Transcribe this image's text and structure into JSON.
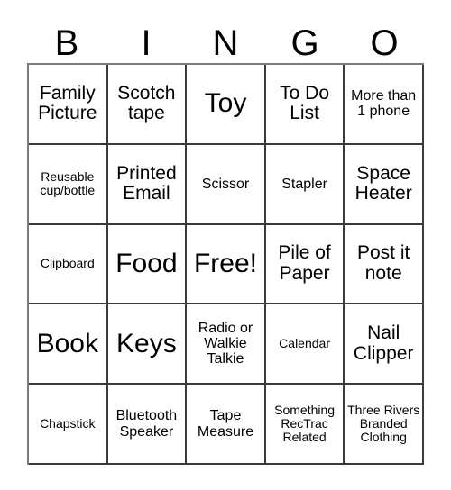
{
  "card": {
    "title_letters": [
      "B",
      "I",
      "N",
      "G",
      "O"
    ],
    "columns": 5,
    "rows": 5,
    "background_color": "#ffffff",
    "text_color": "#000000",
    "grid_border_color": "#3a3a3a",
    "cells": [
      {
        "label": "Family Picture",
        "size": "md"
      },
      {
        "label": "Scotch tape",
        "size": "md"
      },
      {
        "label": "Toy",
        "size": "xl"
      },
      {
        "label": "To Do List",
        "size": "md"
      },
      {
        "label": "More than 1 phone",
        "size": "sm"
      },
      {
        "label": "Reusable cup/bottle",
        "size": "xs"
      },
      {
        "label": "Printed Email",
        "size": "md"
      },
      {
        "label": "Scissor",
        "size": "sm"
      },
      {
        "label": "Stapler",
        "size": "sm"
      },
      {
        "label": "Space Heater",
        "size": "md"
      },
      {
        "label": "Clipboard",
        "size": "xs"
      },
      {
        "label": "Food",
        "size": "xl"
      },
      {
        "label": "Free!",
        "size": "xl"
      },
      {
        "label": "Pile of Paper",
        "size": "md"
      },
      {
        "label": "Post it note",
        "size": "md"
      },
      {
        "label": "Book",
        "size": "xl"
      },
      {
        "label": "Keys",
        "size": "xl"
      },
      {
        "label": "Radio or Walkie Talkie",
        "size": "sm"
      },
      {
        "label": "Calendar",
        "size": "xs"
      },
      {
        "label": "Nail Clipper",
        "size": "md"
      },
      {
        "label": "Chapstick",
        "size": "xs"
      },
      {
        "label": "Bluetooth Speaker",
        "size": "sm"
      },
      {
        "label": "Tape Measure",
        "size": "sm"
      },
      {
        "label": "Something RecTrac Related",
        "size": "xs"
      },
      {
        "label": "Three Rivers Branded Clothing",
        "size": "xs"
      }
    ]
  }
}
